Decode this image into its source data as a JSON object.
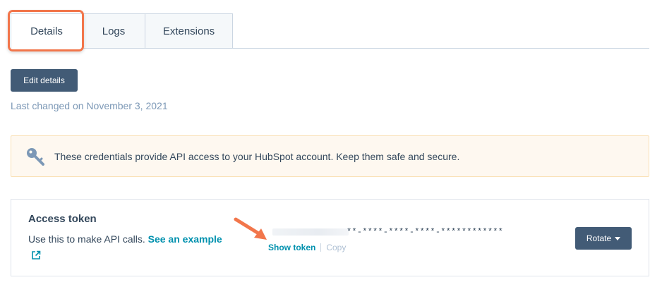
{
  "tabs": [
    {
      "label": "Details",
      "active": true
    },
    {
      "label": "Logs",
      "active": false
    },
    {
      "label": "Extensions",
      "active": false
    }
  ],
  "edit_button_label": "Edit details",
  "last_changed": "Last changed on November 3, 2021",
  "alert": {
    "icon": "key-icon",
    "text": "These credentials provide API access to your HubSpot account. Keep them safe and secure."
  },
  "access_token": {
    "title": "Access token",
    "description": "Use this to make API calls.",
    "example_link": "See an example",
    "external_icon": "external-link-icon",
    "masked_value": "**-****-****-****-************",
    "show_token_label": "Show token",
    "copy_label": "Copy",
    "rotate_label": "Rotate"
  },
  "colors": {
    "primary_button": "#425b76",
    "link": "#0091ae",
    "highlight": "#f2764b",
    "alert_bg": "#fef8f0"
  }
}
